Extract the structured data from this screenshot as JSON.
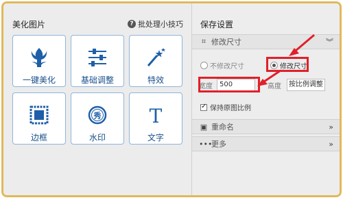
{
  "left_panel": {
    "title": "美化图片",
    "tips_label": "批处理小技巧",
    "tiles": [
      {
        "label": "一键美化",
        "icon": "tulip-icon"
      },
      {
        "label": "基础调整",
        "icon": "sliders-icon"
      },
      {
        "label": "特效",
        "icon": "magic-wand-icon"
      },
      {
        "label": "边框",
        "icon": "stamp-frame-icon"
      },
      {
        "label": "水印",
        "icon": "watermark-seal-icon"
      },
      {
        "label": "文字",
        "icon": "text-T-icon"
      }
    ]
  },
  "right_panel": {
    "title": "保存设置",
    "resize_section": {
      "title": "修改尺寸",
      "option_keep": "不修改尺寸",
      "option_change": "修改尺寸",
      "selected": "修改尺寸",
      "width_label": "宽度",
      "width_value": "500",
      "height_label": "高度",
      "height_mode": "按比例调整",
      "keep_ratio_label": "保持原图比例",
      "keep_ratio_checked": true
    },
    "rename_section": {
      "title": "重命名"
    },
    "more_section": {
      "title": "更多"
    }
  },
  "colors": {
    "frame_border": "#e1b85a",
    "tile_text": "#1a4f8c",
    "annotation_red": "#e0202a"
  }
}
